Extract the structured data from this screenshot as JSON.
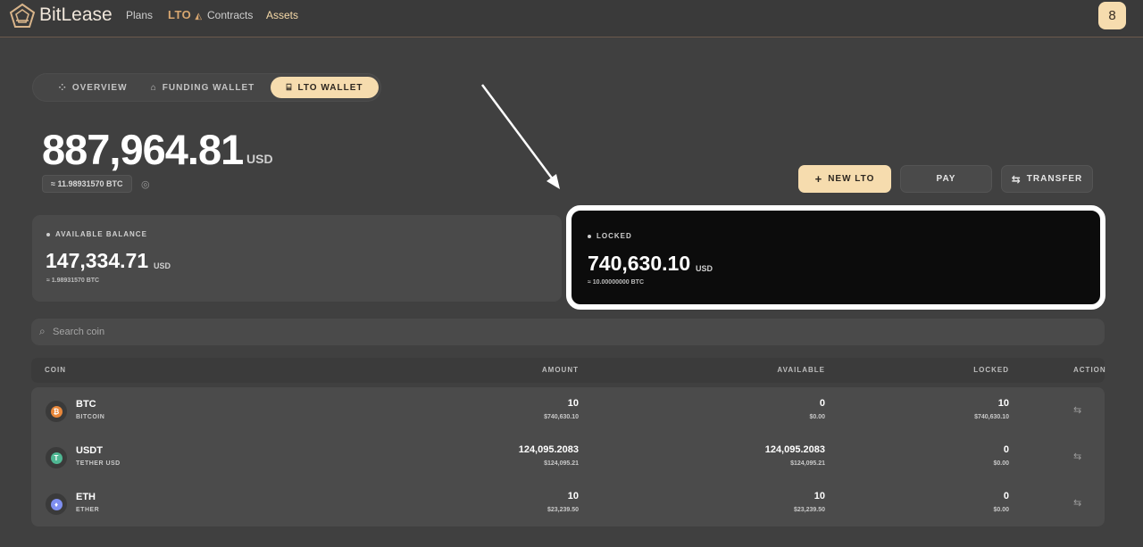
{
  "topbar": {
    "brand": "BitLease",
    "nav": {
      "plans": "Plans",
      "lto": "LTO",
      "contracts": "Contracts",
      "assets": "Assets"
    },
    "avatar_glyph": "8"
  },
  "tabs": [
    {
      "label": "OVERVIEW",
      "icon": "grid-icon"
    },
    {
      "label": "FUNDING WALLET",
      "icon": "wallet-icon"
    },
    {
      "label": "LTO WALLET",
      "icon": "bank-icon",
      "active": true
    }
  ],
  "balance": {
    "total": "887,964.81",
    "unit": "USD",
    "btc_equiv": "≈ 11.98931570 BTC"
  },
  "actions": {
    "new_lto": "NEW LTO",
    "pay": "PAY",
    "transfer": "TRANSFER"
  },
  "cards": {
    "available": {
      "label": "AVAILABLE BALANCE",
      "value": "147,334.71",
      "unit": "USD",
      "sub": "≈ 1.98931570 BTC"
    },
    "locked": {
      "label": "LOCKED",
      "value": "740,630.10",
      "unit": "USD",
      "sub": "≈ 10.00000000 BTC"
    }
  },
  "search": {
    "placeholder": "Search coin",
    "value": ""
  },
  "table": {
    "headers": {
      "coin": "COIN",
      "amount": "AMOUNT",
      "available": "AVAILABLE",
      "locked": "LOCKED",
      "action": "ACTION"
    },
    "rows": [
      {
        "symbol": "BTC",
        "name": "BITCOIN",
        "glyph": "₿",
        "color": "#e8873a",
        "amount": "10",
        "amount_usd": "$740,630.10",
        "available": "0",
        "available_usd": "$0.00",
        "locked": "10",
        "locked_usd": "$740,630.10"
      },
      {
        "symbol": "USDT",
        "name": "TETHER USD",
        "glyph": "T",
        "color": "#4fb793",
        "amount": "124,095.2083",
        "amount_usd": "$124,095.21",
        "available": "124,095.2083",
        "available_usd": "$124,095.21",
        "locked": "0",
        "locked_usd": "$0.00"
      },
      {
        "symbol": "ETH",
        "name": "ETHER",
        "glyph": "♦",
        "color": "#7f8ff0",
        "amount": "10",
        "amount_usd": "$23,239.50",
        "available": "10",
        "available_usd": "$23,239.50",
        "locked": "0",
        "locked_usd": "$0.00"
      }
    ]
  },
  "colors": {
    "accent": "#f6dcae",
    "background": "#404040",
    "locked_card": "#0c0c0c"
  }
}
